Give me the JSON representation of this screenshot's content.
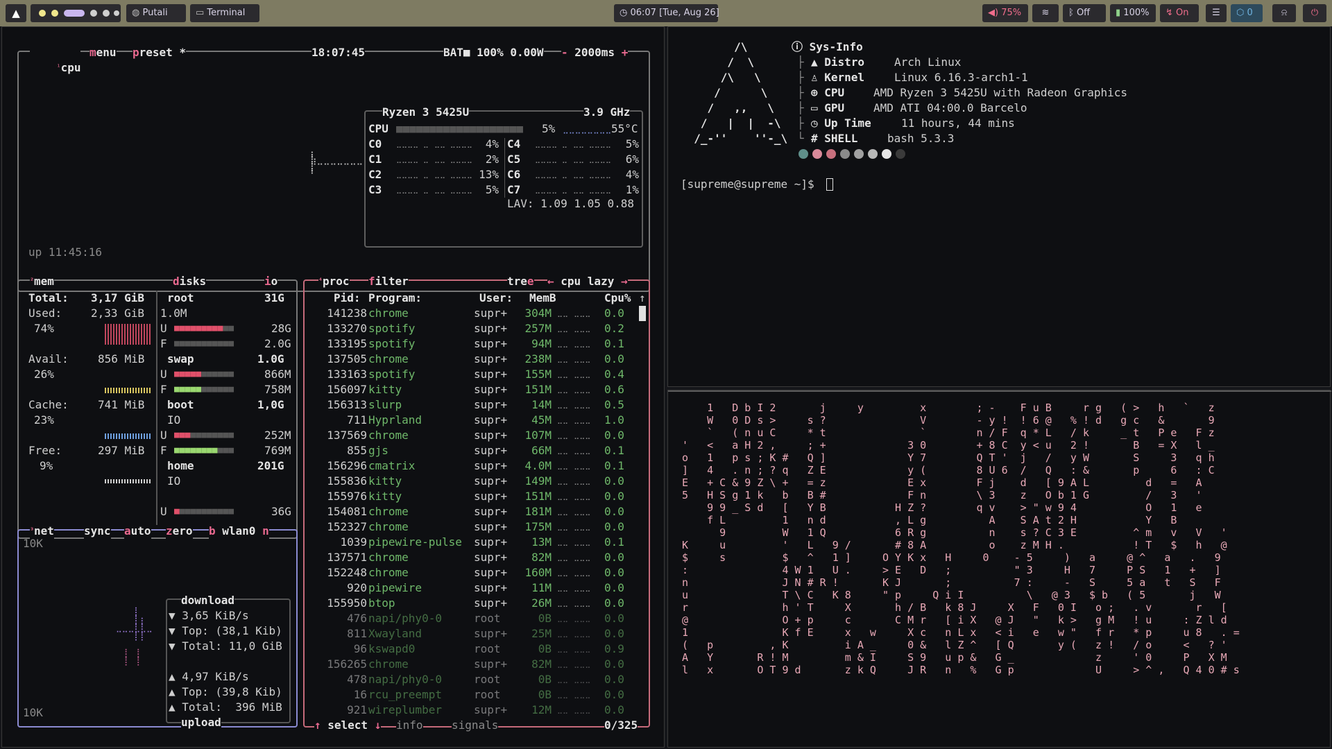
{
  "topbar": {
    "workspace_button": "Putali",
    "terminal_button": "Terminal",
    "clock": "06:07 [Tue, Aug 26]",
    "volume": "75%",
    "bluetooth": "Off",
    "battery": "100%",
    "nightlight": "On",
    "notif_count": "0",
    "colors": {
      "bar": "#7e7b62",
      "pill": "#2b2a2e",
      "accent": "#c9b6ee",
      "warn": "#f06d8c"
    }
  },
  "btop": {
    "cpu_box": {
      "tab_cpu": "cpu",
      "tab_menu": "menu",
      "tab_preset": "preset *",
      "time": "18:07:45",
      "battery": "BAT■ 100% 0.00W",
      "interval": "2000ms",
      "model": "Ryzen 3 5425U",
      "freq": "3.9 GHz",
      "cpu_total": "5%",
      "temp": "55°C",
      "cores": [
        {
          "name": "C0",
          "val": "4%"
        },
        {
          "name": "C1",
          "val": "2%"
        },
        {
          "name": "C2",
          "val": "13%"
        },
        {
          "name": "C3",
          "val": "5%"
        },
        {
          "name": "C4",
          "val": "5%"
        },
        {
          "name": "C5",
          "val": "6%"
        },
        {
          "name": "C6",
          "val": "4%"
        },
        {
          "name": "C7",
          "val": "1%"
        }
      ],
      "lav": "LAV: 1.09 1.05 0.88",
      "uptime": "up 11:45:16"
    },
    "mem_box": {
      "title": "mem",
      "total_label": "Total:",
      "total": "3,17 GiB",
      "used_label": "Used:",
      "used": "2,33 GiB",
      "used_pct": "74%",
      "avail_label": "Avail:",
      "avail": "856 MiB",
      "avail_pct": "26%",
      "cache_label": "Cache:",
      "cache": "741 MiB",
      "cache_pct": "23%",
      "free_label": "Free:",
      "free": "297 MiB",
      "free_pct": "9%"
    },
    "disks_box": {
      "title": "disks",
      "io": "io",
      "root": "root",
      "root_size": "31G",
      "root_io": "1.0M",
      "root_used": "28G",
      "root_free": "2.0G",
      "swap": "swap",
      "swap_size": "1.0G",
      "swap_used": "866M",
      "swap_free": "758M",
      "boot": "boot",
      "boot_size": "1,0G",
      "boot_io": "IO",
      "boot_used": "252M",
      "boot_free": "769M",
      "home": "home",
      "home_size": "201G",
      "home_io": "IO",
      "home_used": "36G"
    },
    "net_box": {
      "tab_net": "net",
      "tab_sync": "sync",
      "tab_auto": "auto",
      "tab_zero": "zero",
      "iface": "wlan0",
      "scale_top": "10K",
      "scale_bottom": "10K",
      "download_title": "download",
      "dl_rate": "▼ 3,65 KiB/s",
      "dl_top": "▼ Top: (38,1 Kib)",
      "dl_total": "▼ Total: 11,0 GiB",
      "ul_rate": "▲ 4,97 KiB/s",
      "ul_top": "▲ Top: (39,8 Kib)",
      "ul_total": "▲ Total:  396 MiB",
      "upload_title": "upload"
    },
    "proc_box": {
      "tab_proc": "proc",
      "tab_filter": "filter",
      "tab_tree": "tree",
      "tab_sort": "cpu lazy",
      "headers": {
        "pid": "Pid:",
        "program": "Program:",
        "user": "User:",
        "mem": "MemB",
        "cpu": "Cpu%"
      },
      "rows": [
        {
          "pid": "141238",
          "prog": "chrome",
          "user": "supr+",
          "mem": "304M",
          "cpu": "0.0"
        },
        {
          "pid": "133270",
          "prog": "spotify",
          "user": "supr+",
          "mem": "257M",
          "cpu": "0.2"
        },
        {
          "pid": "133195",
          "prog": "spotify",
          "user": "supr+",
          "mem": "94M",
          "cpu": "0.1"
        },
        {
          "pid": "137505",
          "prog": "chrome",
          "user": "supr+",
          "mem": "238M",
          "cpu": "0.0"
        },
        {
          "pid": "133163",
          "prog": "spotify",
          "user": "supr+",
          "mem": "155M",
          "cpu": "0.4"
        },
        {
          "pid": "156097",
          "prog": "kitty",
          "user": "supr+",
          "mem": "151M",
          "cpu": "0.6"
        },
        {
          "pid": "156313",
          "prog": "slurp",
          "user": "supr+",
          "mem": "14M",
          "cpu": "0.5"
        },
        {
          "pid": "711",
          "prog": "Hyprland",
          "user": "supr+",
          "mem": "45M",
          "cpu": "1.0"
        },
        {
          "pid": "137569",
          "prog": "chrome",
          "user": "supr+",
          "mem": "107M",
          "cpu": "0.0"
        },
        {
          "pid": "855",
          "prog": "gjs",
          "user": "supr+",
          "mem": "66M",
          "cpu": "0.1"
        },
        {
          "pid": "156296",
          "prog": "cmatrix",
          "user": "supr+",
          "mem": "4.0M",
          "cpu": "0.1"
        },
        {
          "pid": "155836",
          "prog": "kitty",
          "user": "supr+",
          "mem": "149M",
          "cpu": "0.0"
        },
        {
          "pid": "155976",
          "prog": "kitty",
          "user": "supr+",
          "mem": "151M",
          "cpu": "0.0"
        },
        {
          "pid": "154081",
          "prog": "chrome",
          "user": "supr+",
          "mem": "181M",
          "cpu": "0.0"
        },
        {
          "pid": "152327",
          "prog": "chrome",
          "user": "supr+",
          "mem": "175M",
          "cpu": "0.0"
        },
        {
          "pid": "1039",
          "prog": "pipewire-pulse",
          "user": "supr+",
          "mem": "13M",
          "cpu": "0.1"
        },
        {
          "pid": "137571",
          "prog": "chrome",
          "user": "supr+",
          "mem": "82M",
          "cpu": "0.0"
        },
        {
          "pid": "152248",
          "prog": "chrome",
          "user": "supr+",
          "mem": "160M",
          "cpu": "0.0"
        },
        {
          "pid": "920",
          "prog": "pipewire",
          "user": "supr+",
          "mem": "11M",
          "cpu": "0.0"
        },
        {
          "pid": "155950",
          "prog": "btop",
          "user": "supr+",
          "mem": "26M",
          "cpu": "0.0"
        },
        {
          "pid": "476",
          "prog": "napi/phy0-0",
          "user": "root",
          "mem": "0B",
          "cpu": "0.0"
        },
        {
          "pid": "811",
          "prog": "Xwayland",
          "user": "supr+",
          "mem": "25M",
          "cpu": "0.0"
        },
        {
          "pid": "96",
          "prog": "kswapd0",
          "user": "root",
          "mem": "0B",
          "cpu": "0.9"
        },
        {
          "pid": "156265",
          "prog": "chrome",
          "user": "supr+",
          "mem": "82M",
          "cpu": "0.0"
        },
        {
          "pid": "478",
          "prog": "napi/phy0-0",
          "user": "root",
          "mem": "0B",
          "cpu": "0.0"
        },
        {
          "pid": "16",
          "prog": "rcu_preempt",
          "user": "root",
          "mem": "0B",
          "cpu": "0.0"
        },
        {
          "pid": "921",
          "prog": "wireplumber",
          "user": "supr+",
          "mem": "12M",
          "cpu": "0.0"
        }
      ],
      "footer_select": "select",
      "footer_info": "info",
      "footer_signals": "signals",
      "footer_count": "0/325"
    }
  },
  "fetch": {
    "title": "Sys-Info",
    "distro_label": "Distro",
    "distro": "Arch Linux",
    "kernel_label": "Kernel",
    "kernel": "Linux 6.16.3-arch1-1",
    "cpu_label": "CPU",
    "cpu": "AMD Ryzen 3 5425U with Radeon Graphics",
    "gpu_label": "GPU",
    "gpu": "AMD ATI 04:00.0 Barcelo",
    "uptime_label": "Up Time",
    "uptime": "11 hours, 44 mins",
    "shell_label": "SHELL",
    "shell": "bash 5.3.3",
    "prompt": "[supreme@supreme ~]$"
  },
  "cmatrix": {
    "lines": [
      "    1   D b I 2       j     y         x        ; -    F u B     r g   ( >   h   `   z",
      "    W   0 D s >     s ?               V        - y !  ! 6 @   % ! d   g c   &       9",
      "    `   ( n u C     * t               `        n / F  q * L   / k     _ t   P e   F z",
      "'   <   a H 2 ,     ; +             3 0        + 8 C  y < u   2 !       B   = X   l _",
      "o   1   p s ; K #   Q ]             Y 7        Q T '  j   /   y W       S     3   q h",
      "]   4   . n ; ? q   Z E             y (        8 U 6  /   Q   : &       p     6   : C",
      "E   + C & 9 Z \\ +   = z             E x        F j    d   [ 9 A L         d   =   A",
      "5   H S g 1 k   b   B #             F n        \\ 3    z   O b 1 G         /   3   '",
      "    9 9 _ S d   [   Y B           H Z ?        q v    > \" w 9 4           O   1   e",
      "    f L         1   n d           , L g          A    S A t 2 H           Y   B",
      "      9         W   1 Q           6 R g          n    s ? C 3 E         ^ m   v   V   '",
      "K     u         '   L   9 /       # 8 A          o    z M H .           ! T   $   h   @",
      "$     s         $   ^   1 ]     O Y K x   H     0    - 5     )   a     @ ^   a   .   9",
      ":               4 W 1   U .     > E   D   ;          \" 3     H   7     P S   1   +   ]",
      "n               J N # R !       K J       ;          7 :     -   S     5 a   t   S   F",
      "u               T \\ C   K 8     \" p     Q i I          \\   @ 3   $ b   ( 5       j   W",
      "r               h ' T     X       h / B   k 8 J     X   F   0 I   o ;   . v       r   [",
      "@               O + p     c       C M r   [ i X   @ J   \"   k >   g M   ! u     : Z l d",
      "1               K f E     x   w     X c   n L x   < i   e   w \"   f r   * p     u 8   . =",
      "(   p         , K         i A _     0 &   l Z ^   [ Q       y (   z !   / o     <   ? '",
      "A   Y       R ! M         m & I     S 9   u p &   G _             z     ' 0     P   X M",
      "l   x       O T 9 d       z k Q     J R   n   %   G p             U     > ^ ,   Q 4 0 # s"
    ]
  }
}
